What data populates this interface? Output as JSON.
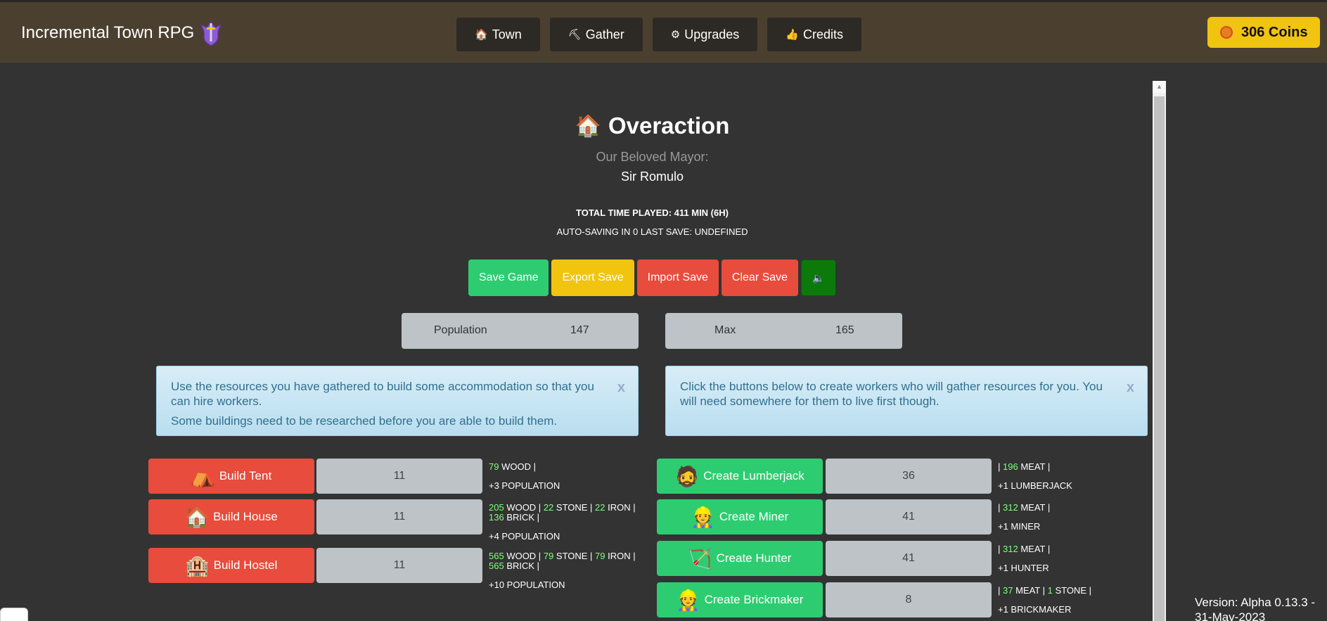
{
  "header": {
    "brand": "Incremental Town RPG",
    "nav": [
      {
        "icon": "🏠",
        "label": "Town"
      },
      {
        "icon": "⛏",
        "label": "Gather"
      },
      {
        "icon": "⚙",
        "label": "Upgrades"
      },
      {
        "icon": "👍",
        "label": "Credits"
      }
    ],
    "coins": "306 Coins"
  },
  "town": {
    "icon": "🏠",
    "name": "Overaction",
    "mayor_label": "Our Beloved Mayor:",
    "mayor_name": "Sir Romulo",
    "time_played": "TOTAL TIME PLAYED: 411 MIN (6H)",
    "autosave": "AUTO-SAVING IN 0 LAST SAVE: UNDEFINED"
  },
  "save_buttons": {
    "save": "Save Game",
    "export": "Export Save",
    "import": "Import Save",
    "clear": "Clear Save",
    "sound_icon": "🔈"
  },
  "stats": {
    "population_label": "Population",
    "population_value": "147",
    "max_label": "Max",
    "max_value": "165"
  },
  "alerts": {
    "left_line1": "Use the resources you have gathered to build some accommodation so that you can hire workers.",
    "left_line2": "Some buildings need to be researched before you are able to build them.",
    "right_line1": "Click the buttons below to create workers who will gather resources for you. You will need somewhere for them to live first though.",
    "close": "x"
  },
  "buildings": [
    {
      "icon": "⛺",
      "label": "Build Tent",
      "count": "11",
      "cost": [
        {
          "n": "79",
          "r": " WOOD | "
        }
      ],
      "effect": "+3 POPULATION"
    },
    {
      "icon": "🏠",
      "label": "Build House",
      "count": "11",
      "cost": [
        {
          "n": "205",
          "r": " WOOD | "
        },
        {
          "n": "22",
          "r": " STONE | "
        },
        {
          "n": "22",
          "r": " IRON | "
        },
        {
          "n": "136",
          "r": " BRICK | "
        }
      ],
      "effect": "+4 POPULATION"
    },
    {
      "icon": "🏨",
      "label": "Build Hostel",
      "count": "11",
      "cost": [
        {
          "n": "565",
          "r": " WOOD | "
        },
        {
          "n": "79",
          "r": " STONE | "
        },
        {
          "n": "79",
          "r": " IRON | "
        },
        {
          "n": "565",
          "r": " BRICK | "
        }
      ],
      "effect": "+10 POPULATION"
    }
  ],
  "workers": [
    {
      "icon": "🧔",
      "label": "Create Lumberjack",
      "count": "36",
      "cost": [
        {
          "p": "| ",
          "n": "196",
          "r": " MEAT | "
        }
      ],
      "effect": "+1 LUMBERJACK"
    },
    {
      "icon": "👷",
      "label": "Create Miner",
      "count": "41",
      "cost": [
        {
          "p": "| ",
          "n": "312",
          "r": " MEAT | "
        }
      ],
      "effect": "+1 MINER"
    },
    {
      "icon": "🏹",
      "label": "Create Hunter",
      "count": "41",
      "cost": [
        {
          "p": "| ",
          "n": "312",
          "r": " MEAT | "
        }
      ],
      "effect": "+1 HUNTER"
    },
    {
      "icon": "👷",
      "label": "Create Brickmaker",
      "count": "8",
      "cost": [
        {
          "p": "| ",
          "n": "37",
          "r": " MEAT | "
        },
        {
          "n": "1",
          "r": " STONE | "
        }
      ],
      "effect": "+1 BRICKMAKER"
    }
  ],
  "version": "Version: Alpha 0.13.3 - 31-May-2023",
  "colors": {
    "header": "#4b4030",
    "bg": "#333333",
    "green": "#2ecc71",
    "red": "#e74c3c",
    "yellow": "#f1c40f"
  }
}
